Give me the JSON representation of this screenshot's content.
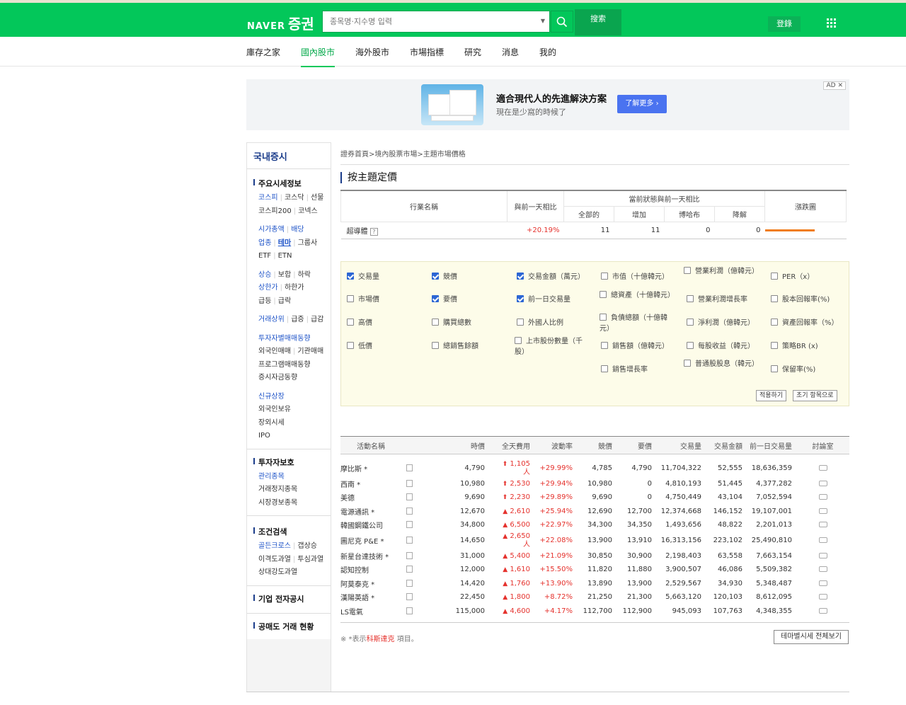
{
  "header": {
    "logo_naver": "NAVER",
    "logo_service": "증권",
    "search_placeholder": "종목명·지수명 입력",
    "search_button": "搜索",
    "login": "登錄"
  },
  "nav": [
    "庫存之家",
    "國內股市",
    "海外股市",
    "市場指標",
    "研究",
    "消息",
    "我的"
  ],
  "nav_active": "國內股市",
  "ad": {
    "title": "適合現代人的先進解決方案",
    "subtitle": "現在是少窩的時候了",
    "button": "了解更多 ›",
    "tag": "AD"
  },
  "sidebar": {
    "title": "국내증시",
    "sections": [
      {
        "title": "주요시세정보",
        "lines": [
          [
            "코스피",
            "코스닥",
            "선물"
          ],
          [
            "코스피200",
            "코넥스"
          ],
          null,
          [
            "시가총액",
            "배당"
          ],
          [
            "업종",
            "테마",
            "그룹사"
          ],
          [
            "ETF",
            "ETN"
          ],
          null,
          [
            "상승",
            "보합",
            "하락"
          ],
          [
            "상한가",
            "하한가"
          ],
          [
            "급등",
            "급락"
          ],
          null,
          [
            "거래상위",
            "급증",
            "급감"
          ],
          null,
          [
            "투자자별매매동향"
          ],
          [
            "외국인매매",
            "기관매매"
          ],
          [
            "프로그램매매동향"
          ],
          [
            "증시자금동향"
          ],
          null,
          [
            "신규상장"
          ],
          [
            "외국인보유"
          ],
          [
            "장외시세"
          ],
          [
            "IPO"
          ]
        ]
      },
      {
        "title": "투자자보호",
        "lines": [
          [
            "관리종목"
          ],
          [
            "거래정지종목"
          ],
          [
            "시장경보종목"
          ]
        ]
      },
      {
        "title": "조건검색",
        "lines": [
          [
            "골든크로스",
            "갭상승"
          ],
          [
            "이격도과열",
            "투심과열"
          ],
          [
            "상대강도과열"
          ]
        ]
      },
      {
        "title": "기업 전자공시",
        "lines": []
      },
      {
        "title": "공매도 거래 현황",
        "lines": []
      }
    ]
  },
  "breadcrumb": "證券首頁>境內股票市場>主題市場價格",
  "page_title": "按主題定價",
  "theme_table": {
    "headers": {
      "name": "行業名稱",
      "change": "與前一天相比",
      "group": "當前狀態與前一天相比",
      "total": "全部的",
      "inc": "增加",
      "flat": "博哈布",
      "dec": "降解",
      "chart": "漲跌圖"
    },
    "row": {
      "name": "超導體",
      "change": "+20.19%",
      "total": "11",
      "inc": "11",
      "flat": "0",
      "dec": "0"
    },
    "bar_fraction": 1.0
  },
  "options": [
    {
      "label": "交易量",
      "checked": true
    },
    {
      "label": "競價",
      "checked": true
    },
    {
      "label": "交易金額（萬元）",
      "checked": true
    },
    {
      "label": "市值（十億韓元）",
      "checked": false
    },
    {
      "label": "營業利潤（億韓元）",
      "checked": false
    },
    {
      "label": "PER（x）",
      "checked": false
    },
    {
      "label": "市場價",
      "checked": false
    },
    {
      "label": "要價",
      "checked": true
    },
    {
      "label": "前一日交易量",
      "checked": true
    },
    {
      "label": "總資產（十億韓元）",
      "checked": false
    },
    {
      "label": "營業利潤增長率",
      "checked": false
    },
    {
      "label": "股本回報率(%)",
      "checked": false
    },
    {
      "label": "高價",
      "checked": false
    },
    {
      "label": "購買總數",
      "checked": false
    },
    {
      "label": "外國人比例",
      "checked": false
    },
    {
      "label": "負債總額（十億韓元）",
      "checked": false
    },
    {
      "label": "淨利潤（億韓元）",
      "checked": false
    },
    {
      "label": "資產回報率（%）",
      "checked": false
    },
    {
      "label": "低價",
      "checked": false
    },
    {
      "label": "總銷售餘額",
      "checked": false
    },
    {
      "label": "上市股份數量（千股）",
      "checked": false
    },
    {
      "label": "銷售額（億韓元）",
      "checked": false
    },
    {
      "label": "每股收益（韓元）",
      "checked": false
    },
    {
      "label": "策略BR (x)",
      "checked": false
    },
    {
      "label": "銷售增長率",
      "checked": false
    },
    {
      "label": "普通股股息（韓元）",
      "checked": false
    },
    {
      "label": "保留率(%)",
      "checked": false
    }
  ],
  "option_buttons": {
    "apply": "적용하기",
    "reset": "초기 항목으로"
  },
  "stock_table": {
    "headers": [
      "活動名稱",
      "時價",
      "全天費用",
      "波動率",
      "競價",
      "要價",
      "交易量",
      "交易金額",
      "前一日交易量",
      "討論室"
    ],
    "rows": [
      {
        "name": "摩比斯 *",
        "price": "4,790",
        "diff": "1,105人",
        "rate": "+29.99%",
        "bid": "4,785",
        "ask": "4,790",
        "vol": "11,704,322",
        "amt": "52,555",
        "prev": "18,636,359",
        "limit": true
      },
      {
        "name": "西南 *",
        "price": "10,980",
        "diff": "2,530",
        "rate": "+29.94%",
        "bid": "10,980",
        "ask": "0",
        "vol": "4,810,193",
        "amt": "51,445",
        "prev": "4,377,282",
        "limit": true
      },
      {
        "name": "美德",
        "price": "9,690",
        "diff": "2,230",
        "rate": "+29.89%",
        "bid": "9,690",
        "ask": "0",
        "vol": "4,750,449",
        "amt": "43,104",
        "prev": "7,052,594",
        "limit": true
      },
      {
        "name": "電源通訊 *",
        "price": "12,670",
        "diff": "2,610",
        "rate": "+25.94%",
        "bid": "12,690",
        "ask": "12,700",
        "vol": "12,374,668",
        "amt": "146,152",
        "prev": "19,107,001",
        "limit": false
      },
      {
        "name": "韓國鋼鐵公司",
        "price": "34,800",
        "diff": "6,500",
        "rate": "+22.97%",
        "bid": "34,300",
        "ask": "34,350",
        "vol": "1,493,656",
        "amt": "48,822",
        "prev": "2,201,013",
        "limit": false
      },
      {
        "name": "圖尼克 P&E *",
        "price": "14,650",
        "diff": "2,650人",
        "rate": "+22.08%",
        "bid": "13,900",
        "ask": "13,910",
        "vol": "16,313,156",
        "amt": "223,102",
        "prev": "25,490,810",
        "limit": false
      },
      {
        "name": "新星台達技術 *",
        "price": "31,000",
        "diff": "5,400",
        "rate": "+21.09%",
        "bid": "30,850",
        "ask": "30,900",
        "vol": "2,198,403",
        "amt": "63,558",
        "prev": "7,663,154",
        "limit": false
      },
      {
        "name": "認知控制",
        "price": "12,000",
        "diff": "1,610",
        "rate": "+15.50%",
        "bid": "11,820",
        "ask": "11,880",
        "vol": "3,900,507",
        "amt": "46,086",
        "prev": "5,509,382",
        "limit": false
      },
      {
        "name": "阿莫泰克 *",
        "price": "14,420",
        "diff": "1,760",
        "rate": "+13.90%",
        "bid": "13,890",
        "ask": "13,900",
        "vol": "2,529,567",
        "amt": "34,930",
        "prev": "5,348,487",
        "limit": false
      },
      {
        "name": "漢陽英語 *",
        "price": "22,450",
        "diff": "1,800",
        "rate": "+8.72%",
        "bid": "21,250",
        "ask": "21,300",
        "vol": "5,663,120",
        "amt": "120,103",
        "prev": "8,612,095",
        "limit": false
      },
      {
        "name": "LS電氣",
        "price": "115,000",
        "diff": "4,600",
        "rate": "+4.17%",
        "bid": "112,700",
        "ask": "112,900",
        "vol": "945,093",
        "amt": "107,763",
        "prev": "4,348,355",
        "limit": false
      }
    ]
  },
  "footer": {
    "note_prefix": "※ *表示",
    "note_link": "科斯達克",
    "note_suffix": "項目。",
    "view_all": "테마별시세 전체보기"
  }
}
